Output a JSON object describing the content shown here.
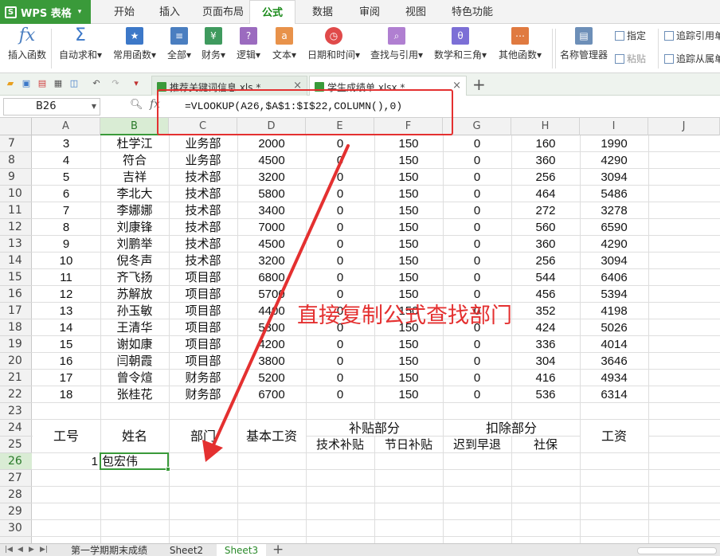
{
  "app": {
    "logo_letter": "S",
    "name": "WPS 表格",
    "menu_arrow": "▾"
  },
  "menu_tabs": [
    "开始",
    "插入",
    "页面布局",
    "公式",
    "数据",
    "审阅",
    "视图",
    "特色功能"
  ],
  "active_menu_tab": 3,
  "ribbon": {
    "buttons": [
      {
        "label": "插入函数",
        "icon": "fx-icon",
        "glyph": "fx"
      },
      {
        "label": "自动求和▾",
        "icon": "sigma-icon",
        "glyph": "Σ"
      },
      {
        "label": "常用函数▾",
        "icon": "star-function-icon",
        "glyph": "★"
      },
      {
        "label": "全部▾",
        "icon": "all-functions-icon",
        "glyph": "≡"
      },
      {
        "label": "财务▾",
        "icon": "finance-icon",
        "glyph": "¥"
      },
      {
        "label": "逻辑▾",
        "icon": "logic-icon",
        "glyph": "?"
      },
      {
        "label": "文本▾",
        "icon": "text-icon",
        "glyph": "a"
      },
      {
        "label": "日期和时间▾",
        "icon": "clock-icon",
        "glyph": "◷"
      },
      {
        "label": "查找与引用▾",
        "icon": "lookup-icon",
        "glyph": "⌕"
      },
      {
        "label": "数学和三角▾",
        "icon": "math-icon",
        "glyph": "θ"
      },
      {
        "label": "其他函数▾",
        "icon": "more-functions-icon",
        "glyph": "⋯"
      },
      {
        "label": "名称管理器",
        "icon": "name-manager-icon",
        "glyph": "▤"
      }
    ],
    "small": {
      "specify": "指定",
      "paste": "粘贴",
      "trace_precedents": "追踪引用单",
      "trace_dependents": "追踪从属单"
    }
  },
  "doc_tabs": [
    {
      "label": "推荐关键词信息.xls *",
      "close": "×"
    },
    {
      "label": "学生成绩单.xlsx *",
      "close": "×"
    }
  ],
  "add_tab": "+",
  "formula_bar": {
    "cell_ref": "B26",
    "fx": "fx",
    "formula": "=VLOOKUP(A26,$A$1:$I$22,COLUMN(),0)"
  },
  "columns": [
    "A",
    "B",
    "C",
    "D",
    "E",
    "F",
    "G",
    "H",
    "I",
    "J"
  ],
  "selected_column": "B",
  "rows": [
    {
      "num": "7",
      "cells": [
        "3",
        "杜学江",
        "业务部",
        "2000",
        "0",
        "150",
        "0",
        "160",
        "1990"
      ]
    },
    {
      "num": "8",
      "cells": [
        "4",
        "符合",
        "业务部",
        "4500",
        "0",
        "150",
        "0",
        "360",
        "4290"
      ]
    },
    {
      "num": "9",
      "cells": [
        "5",
        "吉祥",
        "技术部",
        "3200",
        "0",
        "150",
        "0",
        "256",
        "3094"
      ]
    },
    {
      "num": "10",
      "cells": [
        "6",
        "李北大",
        "技术部",
        "5800",
        "0",
        "150",
        "0",
        "464",
        "5486"
      ]
    },
    {
      "num": "11",
      "cells": [
        "7",
        "李娜娜",
        "技术部",
        "3400",
        "0",
        "150",
        "0",
        "272",
        "3278"
      ]
    },
    {
      "num": "12",
      "cells": [
        "8",
        "刘康锋",
        "技术部",
        "7000",
        "0",
        "150",
        "0",
        "560",
        "6590"
      ]
    },
    {
      "num": "13",
      "cells": [
        "9",
        "刘鹏举",
        "技术部",
        "4500",
        "0",
        "150",
        "0",
        "360",
        "4290"
      ]
    },
    {
      "num": "14",
      "cells": [
        "10",
        "倪冬声",
        "技术部",
        "3200",
        "0",
        "150",
        "0",
        "256",
        "3094"
      ]
    },
    {
      "num": "15",
      "cells": [
        "11",
        "齐飞扬",
        "项目部",
        "6800",
        "0",
        "150",
        "0",
        "544",
        "6406"
      ]
    },
    {
      "num": "16",
      "cells": [
        "12",
        "苏解放",
        "项目部",
        "5700",
        "0",
        "150",
        "0",
        "456",
        "5394"
      ]
    },
    {
      "num": "17",
      "cells": [
        "13",
        "孙玉敏",
        "项目部",
        "4400",
        "0",
        "150",
        "0",
        "352",
        "4198"
      ]
    },
    {
      "num": "18",
      "cells": [
        "14",
        "王清华",
        "项目部",
        "5300",
        "0",
        "150",
        "0",
        "424",
        "5026"
      ]
    },
    {
      "num": "19",
      "cells": [
        "15",
        "谢如康",
        "项目部",
        "4200",
        "0",
        "150",
        "0",
        "336",
        "4014"
      ]
    },
    {
      "num": "20",
      "cells": [
        "16",
        "闫朝霞",
        "项目部",
        "3800",
        "0",
        "150",
        "0",
        "304",
        "3646"
      ]
    },
    {
      "num": "21",
      "cells": [
        "17",
        "曾令煊",
        "财务部",
        "5200",
        "0",
        "150",
        "0",
        "416",
        "4934"
      ]
    },
    {
      "num": "22",
      "cells": [
        "18",
        "张桂花",
        "财务部",
        "6700",
        "0",
        "150",
        "0",
        "536",
        "6314"
      ]
    }
  ],
  "lower_rows": [
    "23",
    "24",
    "25",
    "26",
    "27",
    "28",
    "29",
    "30"
  ],
  "selected_row": "26",
  "header_block": {
    "id": "工号",
    "name": "姓名",
    "dept": "部门",
    "base_salary": "基本工资",
    "allowance": "补贴部分",
    "tech_allowance": "技术补贴",
    "holiday_allowance": "节日补贴",
    "deduction": "扣除部分",
    "late_leave": "迟到早退",
    "social_security": "社保",
    "salary": "工资"
  },
  "input_row": {
    "id": "1",
    "name": "包宏伟"
  },
  "annotation": "直接复制公式查找部门",
  "sheets": [
    "第一学期期末成绩",
    "Sheet2",
    "Sheet3"
  ],
  "active_sheet": 2,
  "add_sheet": "+",
  "colors": {
    "accent": "#3a9a3a",
    "annotation": "#e43030"
  }
}
